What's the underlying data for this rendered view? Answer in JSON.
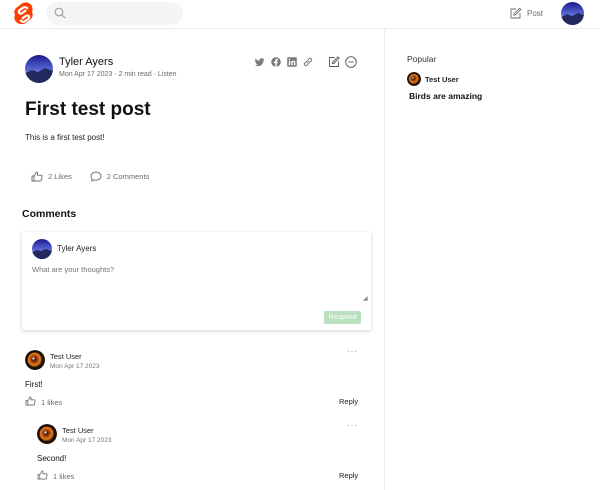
{
  "colors": {
    "brand": "#ff3e00",
    "respond_disabled": "#b9e0be"
  },
  "header": {
    "logo": "svelte-logo",
    "search": {
      "value": "",
      "placeholder": "",
      "icon": "search-icon"
    },
    "write": {
      "label": "Post",
      "icon": "pencil-square-icon"
    },
    "avatar": "user-avatar"
  },
  "post": {
    "author": {
      "name": "Tyler Ayers",
      "date": "Mon Apr 17 2023",
      "read_time": "2 min read",
      "listen": "Listen"
    },
    "share_icons": [
      "twitter-icon",
      "facebook-icon",
      "linkedin-icon",
      "link-icon"
    ],
    "action_icons": [
      "edit-icon",
      "more-circle-icon"
    ],
    "title": "First test post",
    "body": "This is a first test post!",
    "likes": "2 Likes",
    "comments_count": "2 Comments"
  },
  "comments_section": {
    "heading": "Comments",
    "composer": {
      "user_name": "Tyler Ayers",
      "placeholder": "What are your thoughts?",
      "value": "",
      "respond_label": "Respond"
    },
    "items": [
      {
        "author": "Test User",
        "date": "Mon Apr 17 2023",
        "text": "First!",
        "likes": "1 likes",
        "reply_label": "Reply",
        "more_label": "···"
      },
      {
        "author": "Test User",
        "date": "Mon Apr 17 2023",
        "text": "Second!",
        "likes": "1 likes",
        "reply_label": "Reply",
        "more_label": "···"
      }
    ]
  },
  "sidebar": {
    "heading": "Popular",
    "items": [
      {
        "author": "Test User",
        "title": "Birds are amazing"
      }
    ]
  }
}
